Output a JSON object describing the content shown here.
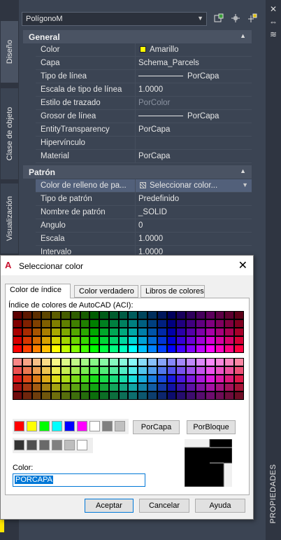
{
  "palette": {
    "object_select": "PolígonoM",
    "left_tabs": [
      "Diseño",
      "Clase de objeto",
      "Visualización"
    ],
    "right_title": "PROPIEDADES",
    "sections": {
      "general": {
        "title": "General",
        "rows": [
          {
            "name": "Color",
            "value": "Amarillo"
          },
          {
            "name": "Capa",
            "value": "Schema_Parcels"
          },
          {
            "name": "Tipo de línea",
            "value": "PorCapa"
          },
          {
            "name": "Escala de tipo de línea",
            "value": "1.0000"
          },
          {
            "name": "Estilo de trazado",
            "value": "PorColor"
          },
          {
            "name": "Grosor de línea",
            "value": "PorCapa"
          },
          {
            "name": "EntityTransparency",
            "value": "PorCapa"
          },
          {
            "name": "Hipervínculo",
            "value": ""
          },
          {
            "name": "Material",
            "value": "PorCapa"
          }
        ]
      },
      "patron": {
        "title": "Patrón",
        "rows": [
          {
            "name": "Color de relleno de pa...",
            "value": "Seleccionar color..."
          },
          {
            "name": "Tipo de patrón",
            "value": "Predefinido"
          },
          {
            "name": "Nombre de patrón",
            "value": "_SOLID"
          },
          {
            "name": "Ángulo",
            "value": "0"
          },
          {
            "name": "Escala",
            "value": "1.0000"
          },
          {
            "name": "Intervalo",
            "value": "1.0000"
          }
        ]
      }
    }
  },
  "dialog": {
    "title": "Seleccionar color",
    "tabs": [
      "Color de índice",
      "Color verdadero",
      "Libros de colores"
    ],
    "aci_label": "Índice de colores de AutoCAD (ACI):",
    "bylayer_button": "PorCapa",
    "byblock_button": "PorBloque",
    "color_label": "Color:",
    "color_value": "PORCAPA",
    "ok_button": "Aceptar",
    "cancel_button": "Cancelar",
    "help_button": "Ayuda",
    "standard_colors": [
      "#ff0000",
      "#ffff00",
      "#00ff00",
      "#00ffff",
      "#0000ff",
      "#ff00ff",
      "#ffffff",
      "#808080",
      "#c0c0c0"
    ],
    "gray_colors": [
      "#333333",
      "#505050",
      "#696969",
      "#808080",
      "#bebebe",
      "#ffffff"
    ],
    "accent": "#0078d7"
  }
}
